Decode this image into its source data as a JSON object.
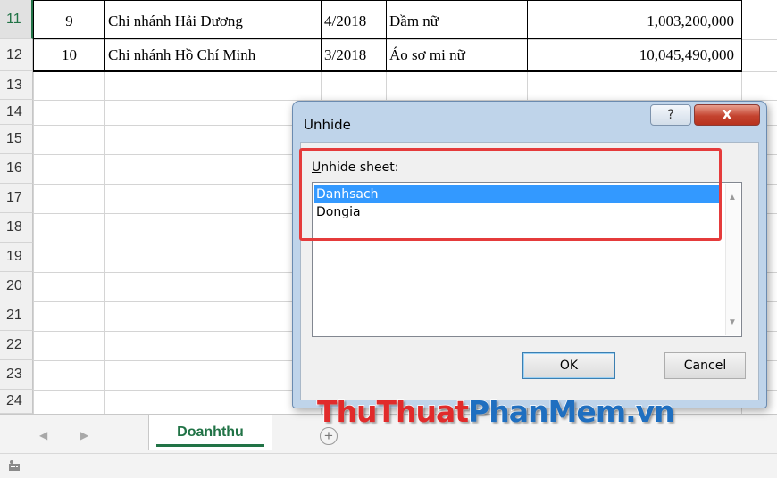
{
  "spreadsheet": {
    "row_numbers": [
      "11",
      "12",
      "13",
      "14",
      "15",
      "16",
      "17",
      "18",
      "19",
      "20",
      "21",
      "22",
      "23",
      "24"
    ],
    "rows": [
      {
        "stt": "9",
        "branch": "Chi nhánh Hải Dương",
        "month": "4/2018",
        "product": "Đầm nữ",
        "amount": "1,003,200,000"
      },
      {
        "stt": "10",
        "branch": "Chi nhánh Hồ Chí Minh",
        "month": "3/2018",
        "product": "Áo sơ mi nữ",
        "amount": "10,045,490,000"
      }
    ]
  },
  "tabbar": {
    "nav_prev_icon": "caret-left-icon",
    "nav_next_icon": "caret-right-icon",
    "active_sheet": "Doanhthu",
    "add_sheet_symbol": "+"
  },
  "dialog": {
    "title": "Unhide",
    "help_symbol": "?",
    "close_symbol": "X",
    "list_label_mnemonic": "U",
    "list_label_rest": "nhide sheet:",
    "sheets": [
      "Danhsach",
      "Dongia"
    ],
    "selected_index": 0,
    "scroll_up": "▲",
    "scroll_down": "▼",
    "ok_label": "OK",
    "cancel_label": "Cancel",
    "highlight_color": "#e53b3b"
  },
  "watermark": {
    "part1": "ThuThuat",
    "part2": "PhanMem.vn"
  },
  "colors": {
    "excel_green": "#217346",
    "selection_blue": "#3399ff"
  }
}
